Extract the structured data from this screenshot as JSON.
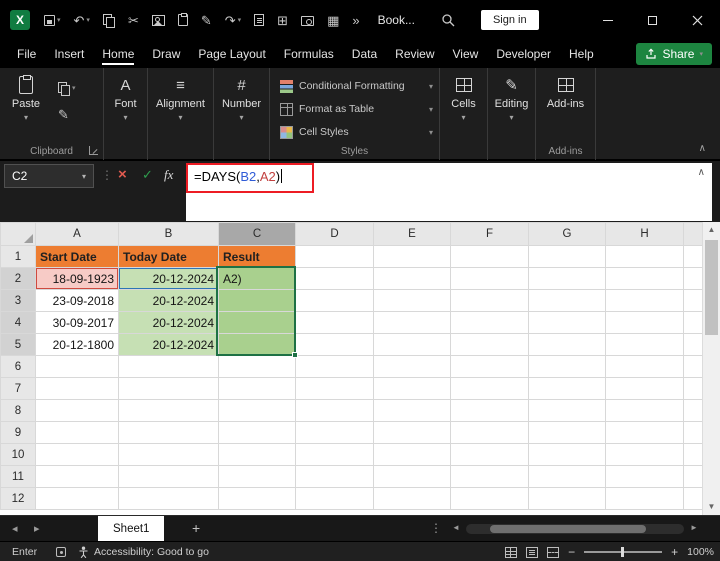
{
  "titlebar": {
    "workbook_title": "Book...",
    "sign_in": "Sign in"
  },
  "menu": {
    "tabs": [
      "File",
      "Insert",
      "Home",
      "Draw",
      "Page Layout",
      "Formulas",
      "Data",
      "Review",
      "View",
      "Developer",
      "Help"
    ],
    "active_tab": "Home",
    "share": "Share"
  },
  "ribbon": {
    "paste": "Paste",
    "font": "Font",
    "alignment": "Alignment",
    "number": "Number",
    "conditional_formatting": "Conditional Formatting",
    "format_as_table": "Format as Table",
    "cell_styles": "Cell Styles",
    "cells": "Cells",
    "editing": "Editing",
    "addins": "Add-ins",
    "group_clipboard": "Clipboard",
    "group_styles": "Styles",
    "group_addins": "Add-ins"
  },
  "formula_bar": {
    "name_box": "C2",
    "fx": "fx",
    "formula": "=DAYS(B2,A2)",
    "part_prefix": "=DAYS(",
    "part_ref1": "B2",
    "part_comma": ",",
    "part_ref2": "A2",
    "part_suffix": ")"
  },
  "grid": {
    "columns": [
      "A",
      "B",
      "C",
      "D",
      "E",
      "F",
      "G",
      "H"
    ],
    "rows": [
      "1",
      "2",
      "3",
      "4",
      "5",
      "6",
      "7",
      "8",
      "9",
      "10",
      "11",
      "12"
    ],
    "active_cell": "C2",
    "cells": {
      "A1": "Start Date",
      "B1": "Today Date",
      "C1": "Result",
      "A2": "18-09-1923",
      "B2": "20-12-2024",
      "C2": "A2)",
      "A3": "23-09-2018",
      "B3": "20-12-2024",
      "A4": "30-09-2017",
      "B4": "20-12-2024",
      "A5": "20-12-1800",
      "B5": "20-12-2024"
    }
  },
  "sheetbar": {
    "tabs": [
      "Sheet1"
    ],
    "active_tab": "Sheet1"
  },
  "statusbar": {
    "mode": "Enter",
    "accessibility": "Accessibility: Good to go",
    "zoom": "100%"
  },
  "colors": {
    "header_row_fill": "#ED7D31",
    "ref_red_fill": "#F7CBC6",
    "today_col_fill": "#C6E0B4",
    "result_col_fill": "#A9D08E",
    "selection_green": "#1E7145",
    "ref_blue_text": "#2F5BD7",
    "ref_red_text": "#C2403F",
    "annotation_red": "#ED1C24",
    "share_green": "#1D8540",
    "excel_green": "#107C41"
  },
  "icons": {
    "excel_logo": "X",
    "undo": "↶",
    "redo": "↷",
    "cut": "✂",
    "pen": "✎",
    "more": "»",
    "table": "▦",
    "borders": "⊞",
    "chevron_down": "▾",
    "chevron_up": "∧",
    "dots_v": "⋮",
    "font_glyph": "A",
    "alignment_glyph": "≡",
    "number_glyph": "#",
    "cancel": "×",
    "enter": "✓",
    "nav_left": "◂",
    "nav_right": "▸",
    "plus": "+",
    "minus": "−",
    "scroll_up": "▲",
    "scroll_down": "▼",
    "scroll_left": "◄",
    "scroll_right": "►"
  }
}
